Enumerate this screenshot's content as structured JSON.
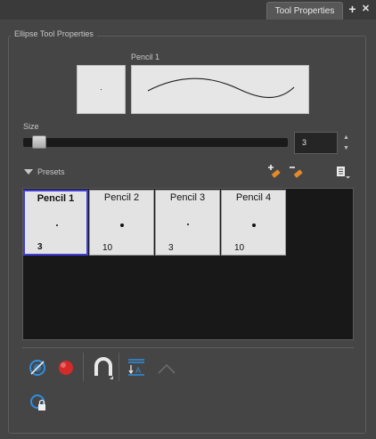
{
  "window": {
    "tab_title": "Tool Properties",
    "add_symbol": "+",
    "close_symbol": "✕"
  },
  "group": {
    "title": "Ellipse Tool Properties"
  },
  "preview": {
    "label": "Pencil 1"
  },
  "size": {
    "label": "Size",
    "value": "3",
    "slider_level": 0.03,
    "spin_up": "▲",
    "spin_down": "▼"
  },
  "presets": {
    "label": "Presets",
    "items": [
      {
        "name": "Pencil 1",
        "size": "3",
        "selected": true
      },
      {
        "name": "Pencil 2",
        "size": "10",
        "selected": false
      },
      {
        "name": "Pencil 3",
        "size": "3",
        "selected": false
      },
      {
        "name": "Pencil 4",
        "size": "10",
        "selected": false
      }
    ]
  },
  "colors": {
    "accent_selected": "#3f3fd8",
    "icon_blue": "#2f8fe0",
    "icon_red": "#d42a2a"
  },
  "icons": {
    "new_preset": "new-brush-preset-icon",
    "rename_preset": "rename-brush-preset-icon",
    "menu": "preset-menu-icon",
    "auto_create": "auto-create-line-icon",
    "fill": "auto-fill-icon",
    "snap": "snap-magnet-icon",
    "flatten": "auto-flatten-icon",
    "arc": "draw-arc-icon",
    "lock": "lock-closed-color-icon"
  }
}
